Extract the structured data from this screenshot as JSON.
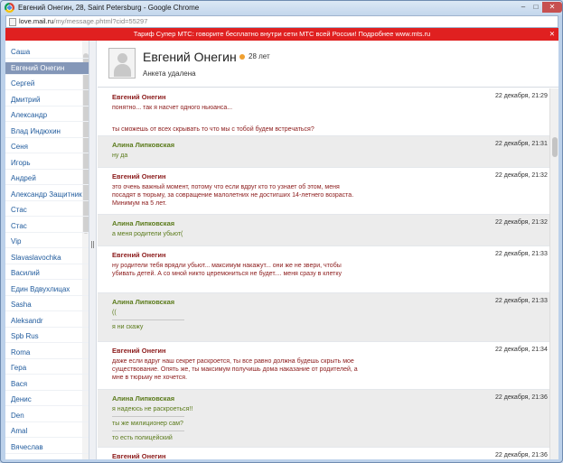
{
  "window": {
    "title": "Евгений Онегин, 28, Saint Petersburg - Google Chrome",
    "minimize": "–",
    "maximize": "□",
    "close": "✕"
  },
  "address": {
    "host": "love.mail.ru",
    "path": "/my/message.phtml?cid=55297"
  },
  "banner": {
    "text": "Тариф Супер МТС: говорите бесплатно внутри сети МТС всей России! Подробнее www.mts.ru",
    "close": "✕"
  },
  "contacts": [
    {
      "label": "Саша"
    },
    {
      "label": "Евгений Онегин",
      "active": true
    },
    {
      "label": "Сергей"
    },
    {
      "label": "Дмитрий"
    },
    {
      "label": "Александр"
    },
    {
      "label": "Влад Индюхин"
    },
    {
      "label": "Сеня"
    },
    {
      "label": "Игорь"
    },
    {
      "label": "Андрей"
    },
    {
      "label": "Александр Защитник"
    },
    {
      "label": "Стас"
    },
    {
      "label": "Стас"
    },
    {
      "label": "Vip"
    },
    {
      "label": "Slavaslavochka"
    },
    {
      "label": "Василий"
    },
    {
      "label": "Един Вдвухлицах"
    },
    {
      "label": "Sasha"
    },
    {
      "label": "Aleksandr"
    },
    {
      "label": "Spb Rus"
    },
    {
      "label": "Roma"
    },
    {
      "label": "Гера"
    },
    {
      "label": "Вася"
    },
    {
      "label": "Денис"
    },
    {
      "label": "Den"
    },
    {
      "label": "Amal"
    },
    {
      "label": "Вячеслав"
    }
  ],
  "profile": {
    "name": "Евгений Онегин",
    "age": "28 лет",
    "status": "Анкета удалена"
  },
  "messages": [
    {
      "author": "Евгений Онегин",
      "time": "22 декабря, 21:29",
      "lines": [
        "понятно... так я насчет одного ньюанса...",
        "",
        "ты сможешь от всех скрывать то что мы с тобой будем встречаться?"
      ]
    },
    {
      "author": "Алина Липковская",
      "time": "22 декабря, 21:31",
      "lines": [
        "ну да"
      ]
    },
    {
      "author": "Евгений Онегин",
      "time": "22 декабря, 21:32",
      "lines": [
        "это очень важный момент, потому что если вдруг кто то узнает об этом, меня",
        "посадят в тюрьму, за совращение малолетних не достигших 14-летнего возраста.",
        "Минимум на 5 лет."
      ]
    },
    {
      "author": "Алина Липковская",
      "time": "22 декабря, 21:32",
      "lines": [
        "а меня родители убьют("
      ]
    },
    {
      "author": "Евгений Онегин",
      "time": "22 декабря, 21:33",
      "lines": [
        "ну родители тебя врядли убьют... максимум накажут... они же не звери, чтобы",
        "убивать детей. А со мной никто церемониться не будет.... меня сразу в клетку"
      ]
    },
    {
      "author": "Алина Липковская",
      "time": "22 декабря, 21:33",
      "lines": [
        "((",
        "я ни скажу"
      ]
    },
    {
      "author": "Евгений Онегин",
      "time": "22 декабря, 21:34",
      "lines": [
        "даже если вдруг наш секрет раскроется, ты все равно должна будешь скрыть мое",
        "существование. Опять же, ты максимум получишь дома наказание от родителей, а",
        "мне в тюрьму не хочется."
      ]
    },
    {
      "author": "Алина Липковская",
      "time": "22 декабря, 21:36",
      "lines": [
        "я надеюсь не раскроеться!!",
        "ты же милиционер сам?",
        "то есть полицейский"
      ]
    },
    {
      "author": "Евгений Онегин",
      "time": "22 декабря, 21:36",
      "lines": []
    }
  ]
}
